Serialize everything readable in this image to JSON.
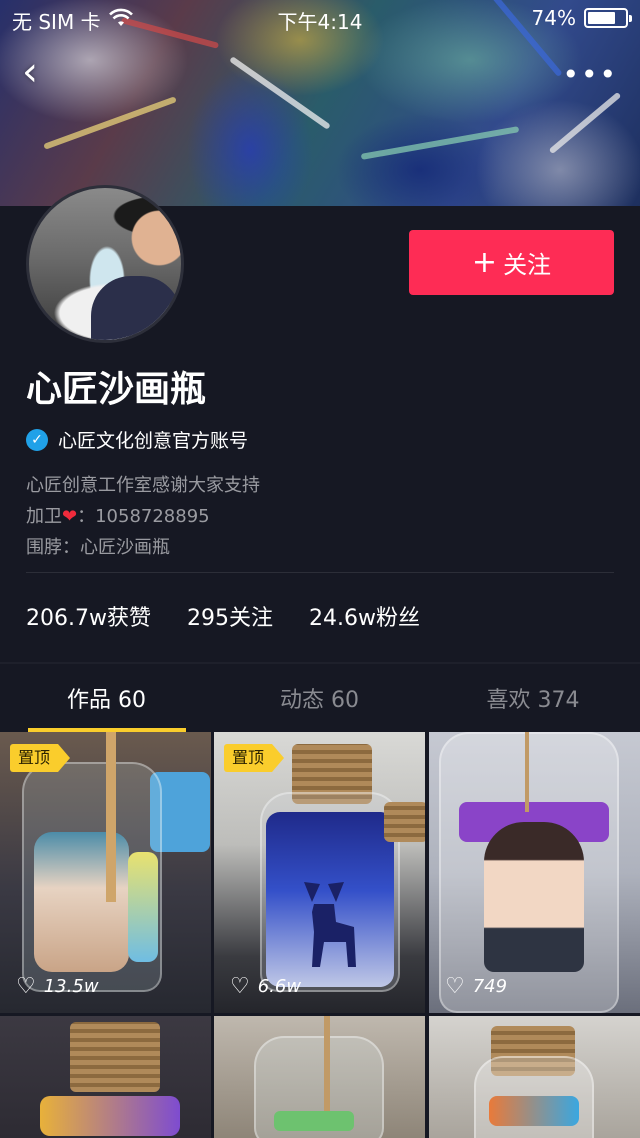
{
  "status_bar": {
    "carrier": "无 SIM 卡",
    "time": "下午4:14",
    "battery": "74%",
    "battery_level": 0.74
  },
  "nav": {
    "back_icon": "chevron-left-icon",
    "more_icon": "more-dots-icon"
  },
  "profile": {
    "name": "心匠沙画瓶",
    "verified_label": "心匠文化创意官方账号",
    "bio_lines": [
      "心匠创意工作室感谢大家支持",
      "加卫",
      "：1058728895",
      "围脖：心匠沙画瓶"
    ],
    "follow_label": "关注",
    "stats": {
      "likes": "206.7w获赞",
      "following": "295关注",
      "followers": "24.6w粉丝"
    }
  },
  "tabs": [
    {
      "label": "作品 60",
      "active": true
    },
    {
      "label": "动态 60",
      "active": false
    },
    {
      "label": "喜欢 374",
      "active": false
    }
  ],
  "videos": [
    {
      "pinned": true,
      "pin_label": "置顶",
      "likes": "13.5w"
    },
    {
      "pinned": true,
      "pin_label": "置顶",
      "likes": "6.6w"
    },
    {
      "pinned": false,
      "likes": "749"
    },
    {
      "pinned": false,
      "likes": ""
    },
    {
      "pinned": false,
      "likes": ""
    },
    {
      "pinned": false,
      "likes": ""
    }
  ],
  "colors": {
    "background": "#161823",
    "accent": "#fe2c55",
    "tab_indicator": "#facd2c",
    "verified": "#20a1e8"
  }
}
